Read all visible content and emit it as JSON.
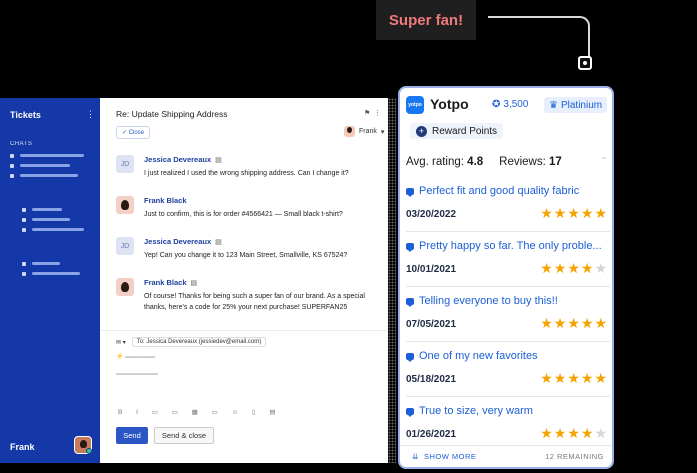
{
  "badge": {
    "label": "Super fan!"
  },
  "sidebar": {
    "title": "Tickets",
    "section": "CHATS",
    "user": "Frank"
  },
  "conversation": {
    "title": "Re: Update Shipping Address",
    "status_button": "Close",
    "assignee": "Frank",
    "messages": [
      {
        "initials": "JD",
        "author": "Jessica Devereaux",
        "text": "I just realized I used the wrong shipping address. Can I change it?"
      },
      {
        "initials": "",
        "author": "Frank Black",
        "text": "Just to confirm, this is for order #4566421 — Small black t-shirt?"
      },
      {
        "initials": "JD",
        "author": "Jessica Devereaux",
        "text": "Yep! Can you change it to 123 Main Street, Smallville, KS 67524?"
      },
      {
        "initials": "",
        "author": "Frank Black",
        "text": "Of course! Thanks for being such a super fan of our brand. As a special thanks, here's a code for 25% your next purchase! SUPERFAN25"
      }
    ],
    "composer": {
      "to_label": "To:",
      "to_value": "Jessica Devereaux (jessiedev@email.com)",
      "send": "Send",
      "send_close": "Send & close"
    }
  },
  "yotpo": {
    "logo_text": "yotpo",
    "name": "Yotpo",
    "points": "3,500",
    "tier": "Platinium",
    "reward_button": "Reward Points",
    "avg_label": "Avg. rating:",
    "avg_value": "4.8",
    "reviews_label": "Reviews:",
    "reviews_value": "17",
    "reviews": [
      {
        "title": "Perfect fit and good quality fabric",
        "date": "03/20/2022",
        "rating": 5
      },
      {
        "title": "Pretty happy so far. The only proble...",
        "date": "10/01/2021",
        "rating": 4
      },
      {
        "title": "Telling everyone to buy this!!",
        "date": "07/05/2021",
        "rating": 5
      },
      {
        "title": "One of my new favorites",
        "date": "05/18/2021",
        "rating": 5
      },
      {
        "title": "True to size, very warm",
        "date": "01/26/2021",
        "rating": 4
      }
    ],
    "show_more": "SHOW MORE",
    "remaining": "12 REMAINING"
  },
  "colors": {
    "brand_blue": "#1538a8",
    "link_blue": "#1d5fd6",
    "star": "#f5a300",
    "badge_text": "#f07a7a"
  }
}
